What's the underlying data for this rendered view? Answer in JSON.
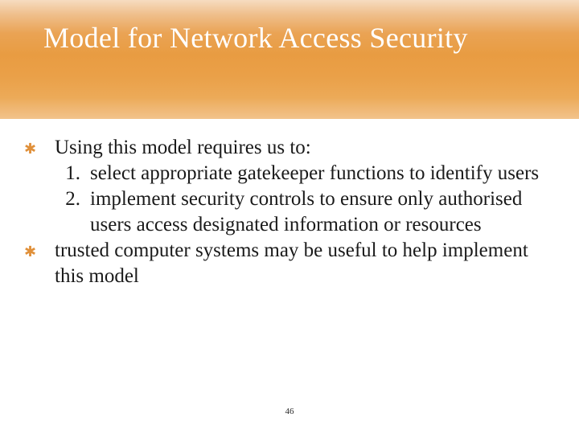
{
  "title": "Model for Network Access Security",
  "bullets": [
    {
      "text": "Using this model requires us to:"
    },
    {
      "text": "trusted computer systems may be useful to help implement this model"
    }
  ],
  "numbered": [
    {
      "n": "1.",
      "text": "select appropriate gatekeeper functions to identify users"
    },
    {
      "n": "2.",
      "text": "implement security controls to ensure only authorised users access designated information or resources"
    }
  ],
  "page_number": "46"
}
